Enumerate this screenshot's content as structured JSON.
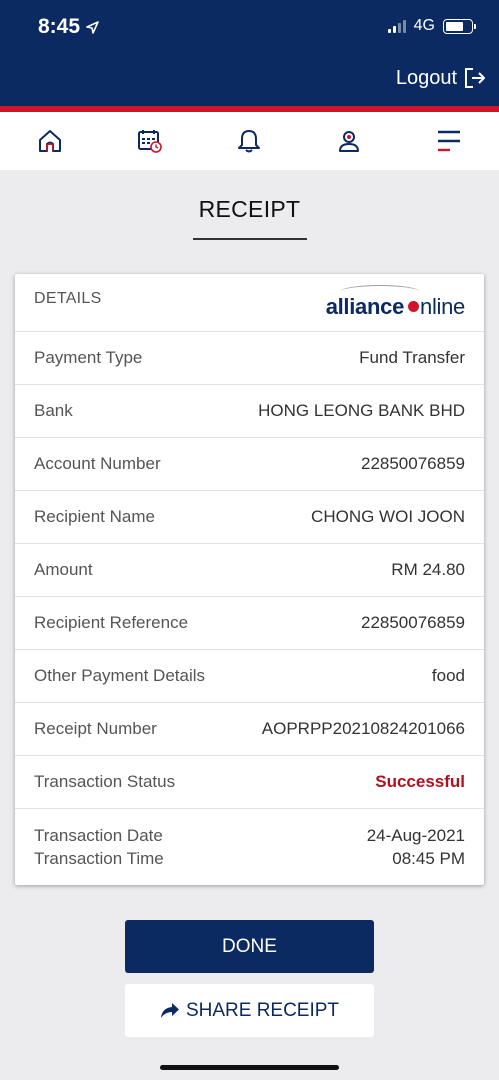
{
  "status_bar": {
    "time": "8:45",
    "network": "4G"
  },
  "header": {
    "logout_label": "Logout"
  },
  "nav": {
    "items": [
      "home-icon",
      "calendar-icon",
      "bell-icon",
      "profile-icon",
      "menu-icon"
    ]
  },
  "page": {
    "title": "RECEIPT"
  },
  "card": {
    "details_label": "DETAILS",
    "logo": {
      "part1": "alliance",
      "part2": "nline"
    },
    "rows": [
      {
        "label": "Payment Type",
        "value": "Fund Transfer"
      },
      {
        "label": "Bank",
        "value": "HONG LEONG BANK BHD"
      },
      {
        "label": "Account Number",
        "value": "22850076859"
      },
      {
        "label": "Recipient Name",
        "value": "CHONG WOI JOON"
      },
      {
        "label": "Amount",
        "value": "RM 24.80"
      },
      {
        "label": "Recipient Reference",
        "value": "22850076859"
      },
      {
        "label": "Other Payment Details",
        "value": "food"
      },
      {
        "label": "Receipt Number",
        "value": "AOPRPP20210824201066"
      },
      {
        "label": "Transaction Status",
        "value": "Successful"
      }
    ],
    "date_time": {
      "date_label": "Transaction Date",
      "time_label": "Transaction Time",
      "date_value": "24-Aug-2021",
      "time_value": "08:45 PM"
    }
  },
  "actions": {
    "done_label": "DONE",
    "share_label": "SHARE RECEIPT"
  },
  "colors": {
    "brand_navy": "#0c2a62",
    "brand_red": "#d0142a",
    "success_text": "#b01020"
  }
}
